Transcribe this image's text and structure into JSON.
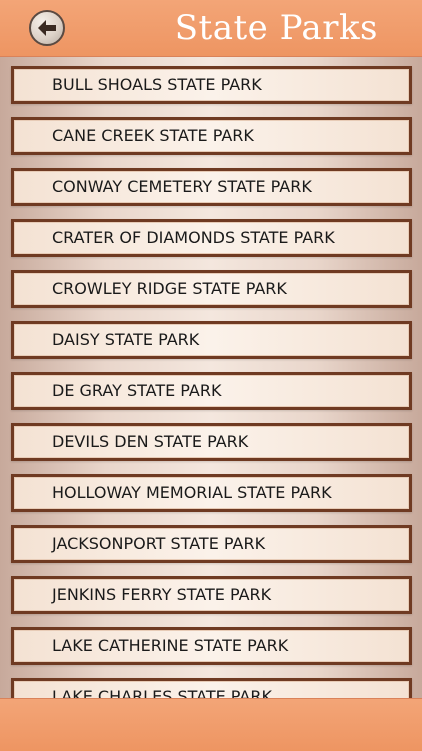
{
  "header": {
    "title": "State Parks",
    "back_icon": "back-arrow-icon"
  },
  "parks": [
    "BULL SHOALS STATE PARK",
    "CANE CREEK STATE PARK",
    "CONWAY CEMETERY STATE PARK",
    "CRATER OF DIAMONDS STATE PARK",
    "CROWLEY RIDGE STATE PARK",
    "DAISY STATE PARK",
    "DE GRAY STATE PARK",
    "DEVILS DEN STATE PARK",
    "HOLLOWAY MEMORIAL STATE PARK",
    "JACKSONPORT STATE PARK",
    "JENKINS FERRY STATE PARK",
    "LAKE CATHERINE STATE PARK",
    "LAKE CHARLES STATE PARK"
  ],
  "colors": {
    "header": "#ee9562",
    "item_border": "#6f3a22",
    "item_bg": "#fbf2ea"
  }
}
